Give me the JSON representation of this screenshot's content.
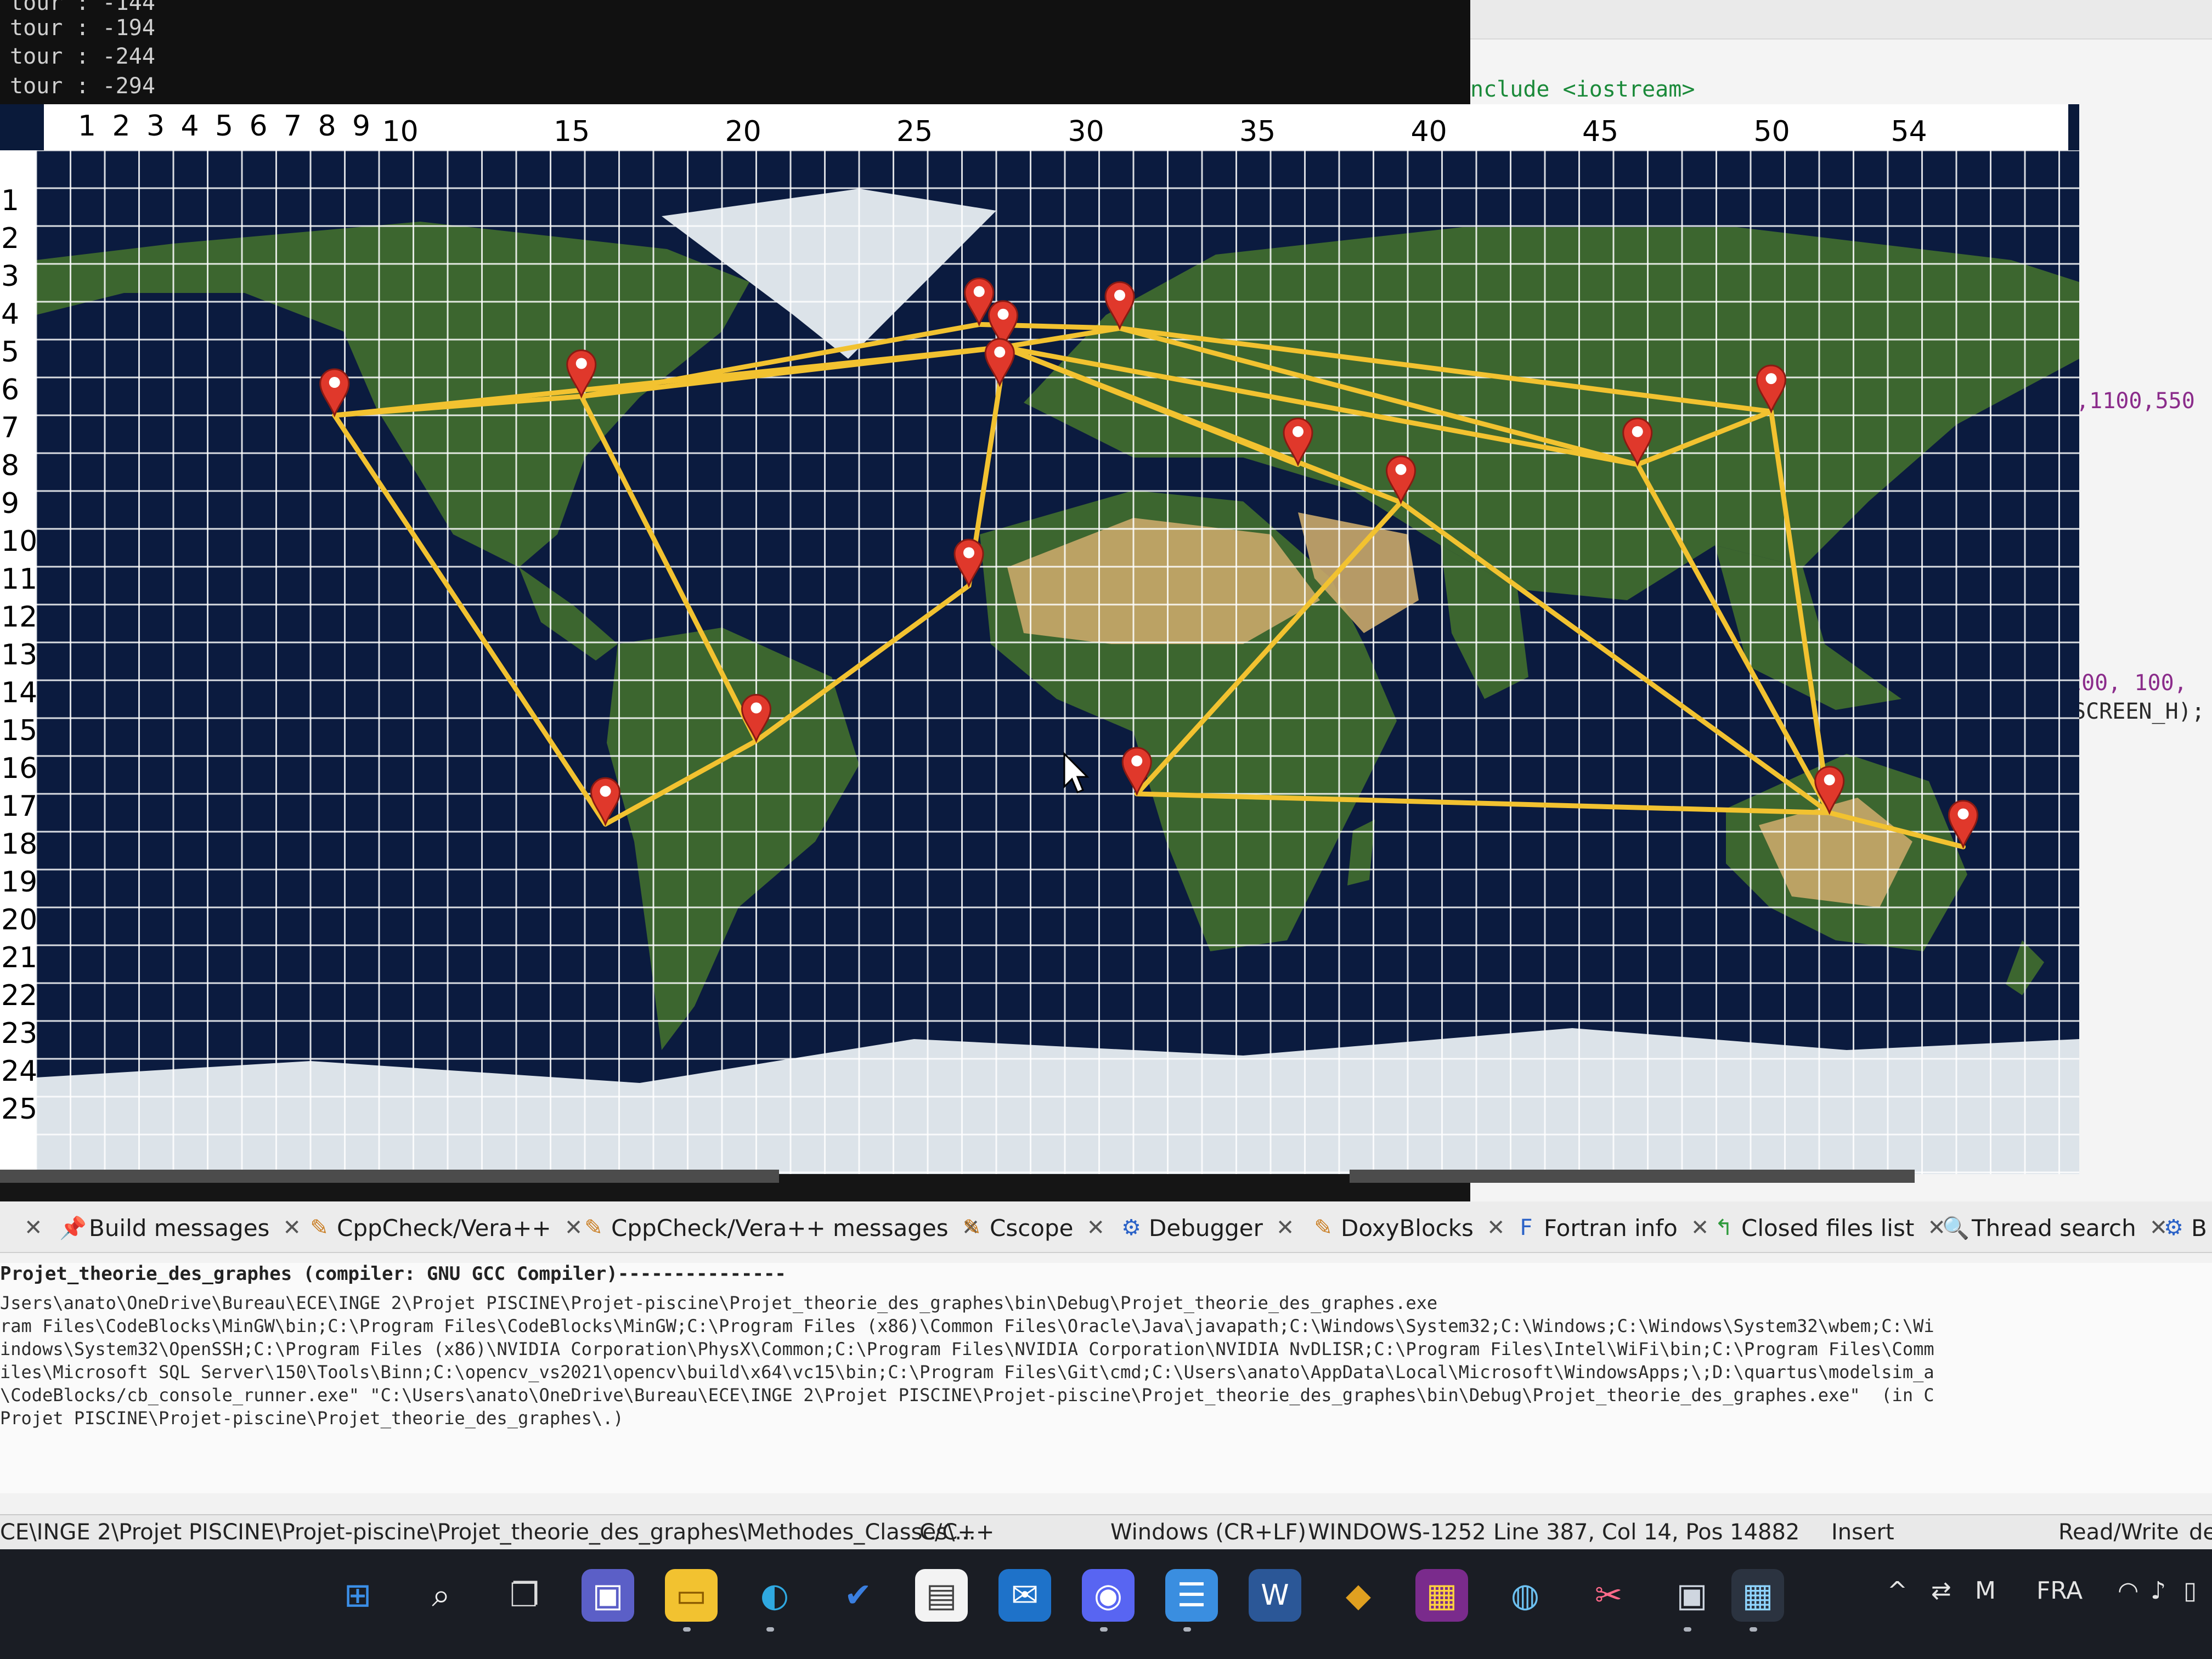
{
  "console": {
    "lines": [
      "tour : -144",
      "tour : -194",
      "tour : -244",
      "tour : -294"
    ]
  },
  "editor": {
    "include_line": "nclude <iostream>",
    "code_args1": "D,1100,550",
    "code_args2": "200, 100,",
    "code_args3": "SCREEN_H);"
  },
  "graph_window": {
    "column_ruler": [
      "1",
      "2",
      "3",
      "4",
      "5",
      "6",
      "7",
      "8",
      "9",
      "10",
      "15",
      "20",
      "25",
      "30",
      "35",
      "40",
      "45",
      "50",
      "54"
    ],
    "row_ruler": [
      "1",
      "2",
      "3",
      "4",
      "5",
      "6",
      "7",
      "8",
      "9",
      "10",
      "11",
      "12",
      "13",
      "14",
      "15",
      "16",
      "17",
      "18",
      "19",
      "20",
      "21",
      "22",
      "23",
      "24",
      "25"
    ],
    "graph": {
      "grid_columns": 54,
      "grid_rows": 26,
      "nodes": [
        {
          "id": "los-angeles",
          "col": 9.7,
          "row": 8.0
        },
        {
          "id": "new-york",
          "col": 16.9,
          "row": 7.5
        },
        {
          "id": "london",
          "col": 28.5,
          "row": 5.6
        },
        {
          "id": "paris",
          "col": 29.2,
          "row": 6.2
        },
        {
          "id": "moscow",
          "col": 32.6,
          "row": 5.7
        },
        {
          "id": "madrid",
          "col": 29.1,
          "row": 7.2
        },
        {
          "id": "lagos",
          "col": 28.2,
          "row": 12.5
        },
        {
          "id": "dubai",
          "col": 37.8,
          "row": 9.3
        },
        {
          "id": "mumbai",
          "col": 40.8,
          "row": 10.3
        },
        {
          "id": "beijing-hong-kong",
          "col": 47.7,
          "row": 9.3
        },
        {
          "id": "tokyo",
          "col": 51.6,
          "row": 7.9
        },
        {
          "id": "rio",
          "col": 22.0,
          "row": 16.6
        },
        {
          "id": "santiago",
          "col": 17.6,
          "row": 18.8
        },
        {
          "id": "cape-town",
          "col": 33.1,
          "row": 18.0
        },
        {
          "id": "sydney",
          "col": 53.3,
          "row": 18.5
        },
        {
          "id": "auckland",
          "col": 57.2,
          "row": 19.4
        }
      ],
      "edges": [
        [
          "los-angeles",
          "new-york"
        ],
        [
          "los-angeles",
          "paris"
        ],
        [
          "los-angeles",
          "santiago"
        ],
        [
          "new-york",
          "london"
        ],
        [
          "new-york",
          "paris"
        ],
        [
          "new-york",
          "rio"
        ],
        [
          "london",
          "moscow"
        ],
        [
          "paris",
          "moscow"
        ],
        [
          "paris",
          "madrid"
        ],
        [
          "paris",
          "dubai"
        ],
        [
          "paris",
          "mumbai"
        ],
        [
          "paris",
          "beijing-hong-kong"
        ],
        [
          "moscow",
          "tokyo"
        ],
        [
          "moscow",
          "beijing-hong-kong"
        ],
        [
          "madrid",
          "lagos"
        ],
        [
          "lagos",
          "rio"
        ],
        [
          "rio",
          "santiago"
        ],
        [
          "mumbai",
          "cape-town"
        ],
        [
          "mumbai",
          "sydney"
        ],
        [
          "beijing-hong-kong",
          "tokyo"
        ],
        [
          "beijing-hong-kong",
          "sydney"
        ],
        [
          "tokyo",
          "sydney"
        ],
        [
          "cape-town",
          "sydney"
        ],
        [
          "sydney",
          "auckland"
        ]
      ],
      "colors": {
        "edge": "#f2c230",
        "pin": "#e0382b",
        "grid": "#ffffff",
        "ocean": "#0b1b3f",
        "land": "#3f6a2e",
        "desert": "#c9a96a",
        "ice": "#e8eef2"
      }
    }
  },
  "bottom_panel": {
    "tabs": [
      {
        "icon": "pin-icon",
        "label": "Build messages"
      },
      {
        "icon": "pencil-icon",
        "label": "CppCheck/Vera++"
      },
      {
        "icon": "pencil-icon",
        "label": "CppCheck/Vera++ messages"
      },
      {
        "icon": "pencil-icon",
        "label": "Cscope"
      },
      {
        "icon": "gear-icon",
        "label": "Debugger"
      },
      {
        "icon": "pencil-icon",
        "label": "DoxyBlocks"
      },
      {
        "icon": "fortran-icon",
        "label": "Fortran info"
      },
      {
        "icon": "arrow-icon",
        "label": "Closed files list"
      },
      {
        "icon": "search-icon",
        "label": "Thread search"
      },
      {
        "icon": "gear-icon",
        "label": "B"
      }
    ],
    "log_lines": [
      "Projet_theorie_des_graphes (compiler: GNU GCC Compiler)---------------",
      "Jsers\\anato\\OneDrive\\Bureau\\ECE\\INGE 2\\Projet PISCINE\\Projet-piscine\\Projet_theorie_des_graphes\\bin\\Debug\\Projet_theorie_des_graphes.exe",
      "ram Files\\CodeBlocks\\MinGW\\bin;C:\\Program Files\\CodeBlocks\\MinGW;C:\\Program Files (x86)\\Common Files\\Oracle\\Java\\javapath;C:\\Windows\\System32;C:\\Windows;C:\\Windows\\System32\\wbem;C:\\Wi",
      "indows\\System32\\OpenSSH;C:\\Program Files (x86)\\NVIDIA Corporation\\PhysX\\Common;C:\\Program Files\\NVIDIA Corporation\\NVIDIA NvDLISR;C:\\Program Files\\Intel\\WiFi\\bin;C:\\Program Files\\Comm",
      "iles\\Microsoft SQL Server\\150\\Tools\\Binn;C:\\opencv_vs2021\\opencv\\build\\x64\\vc15\\bin;C:\\Program Files\\Git\\cmd;C:\\Users\\anato\\AppData\\Local\\Microsoft\\WindowsApps;\\;D:\\quartus\\modelsim_a",
      "\\CodeBlocks/cb_console_runner.exe\" \"C:\\Users\\anato\\OneDrive\\Bureau\\ECE\\INGE 2\\Projet PISCINE\\Projet-piscine\\Projet_theorie_des_graphes\\bin\\Debug\\Projet_theorie_des_graphes.exe\"  (in C",
      "Projet PISCINE\\Projet-piscine\\Projet_theorie_des_graphes\\.)"
    ]
  },
  "status_bar": {
    "path": "CE\\INGE 2\\Projet PISCINE\\Projet-piscine\\Projet_theorie_des_graphes\\Methodes_Classes\\...",
    "language": "C/C++",
    "line_endings": "Windows (CR+LF)",
    "encoding": "WINDOWS-1252",
    "position": "Line 387, Col 14, Pos 14882",
    "mode": "Insert",
    "access": "Read/Write",
    "extra": "de"
  },
  "taskbar": {
    "icons": [
      "windows-start-icon",
      "search-icon",
      "task-view-icon",
      "teams-chat-icon",
      "file-explorer-icon",
      "edge-icon",
      "todo-icon",
      "store-icon",
      "mail-icon",
      "discord-icon",
      "notepad-icon",
      "word-icon",
      "git-icon",
      "winrar-icon",
      "paint-icon",
      "snipping-tool-icon",
      "app-window-icon",
      "codeblocks-icon"
    ],
    "tray": {
      "language": "FRA"
    }
  }
}
